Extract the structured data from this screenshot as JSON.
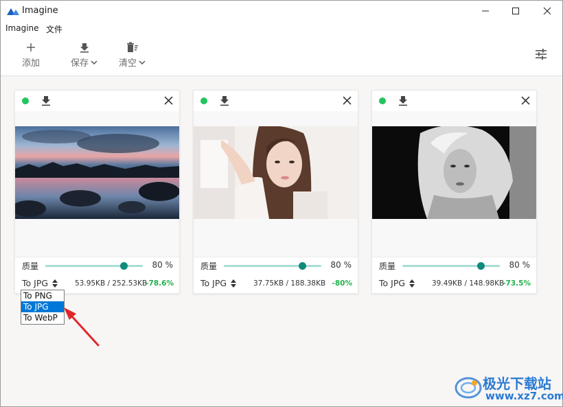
{
  "window": {
    "title": "Imagine"
  },
  "menu": {
    "items": [
      "Imagine",
      "文件"
    ]
  },
  "toolbar": {
    "add": "添加",
    "save": "保存",
    "clear": "清空"
  },
  "quality_label": "质量",
  "cards": [
    {
      "quality": 80,
      "quality_text": "80 %",
      "format": "To JPG",
      "sizes": "53.95KB / 252.53KB",
      "change": "-78.6%",
      "image": "lake-sunset-photo"
    },
    {
      "quality": 80,
      "quality_text": "80 %",
      "format": "To JPG",
      "sizes": "37.75KB / 188.38KB",
      "change": "-80%",
      "image": "woman-portrait-photo"
    },
    {
      "quality": 80,
      "quality_text": "80 %",
      "format": "To JPG",
      "sizes": "39.49KB / 148.98KB",
      "change": "-73.5%",
      "image": "bw-portrait-photo"
    }
  ],
  "format_dropdown": {
    "options": [
      "To PNG",
      "To JPG",
      "To WebP"
    ],
    "selected": "To JPG"
  },
  "watermark": {
    "title": "极光下载站",
    "url": "www.xz7.com"
  },
  "colors": {
    "status": "#22c55e",
    "accent": "#0f8a7c",
    "track": "#a8dcd8",
    "saving": "#22b14c",
    "selection": "#0078d7",
    "arrow": "#e0282a"
  }
}
